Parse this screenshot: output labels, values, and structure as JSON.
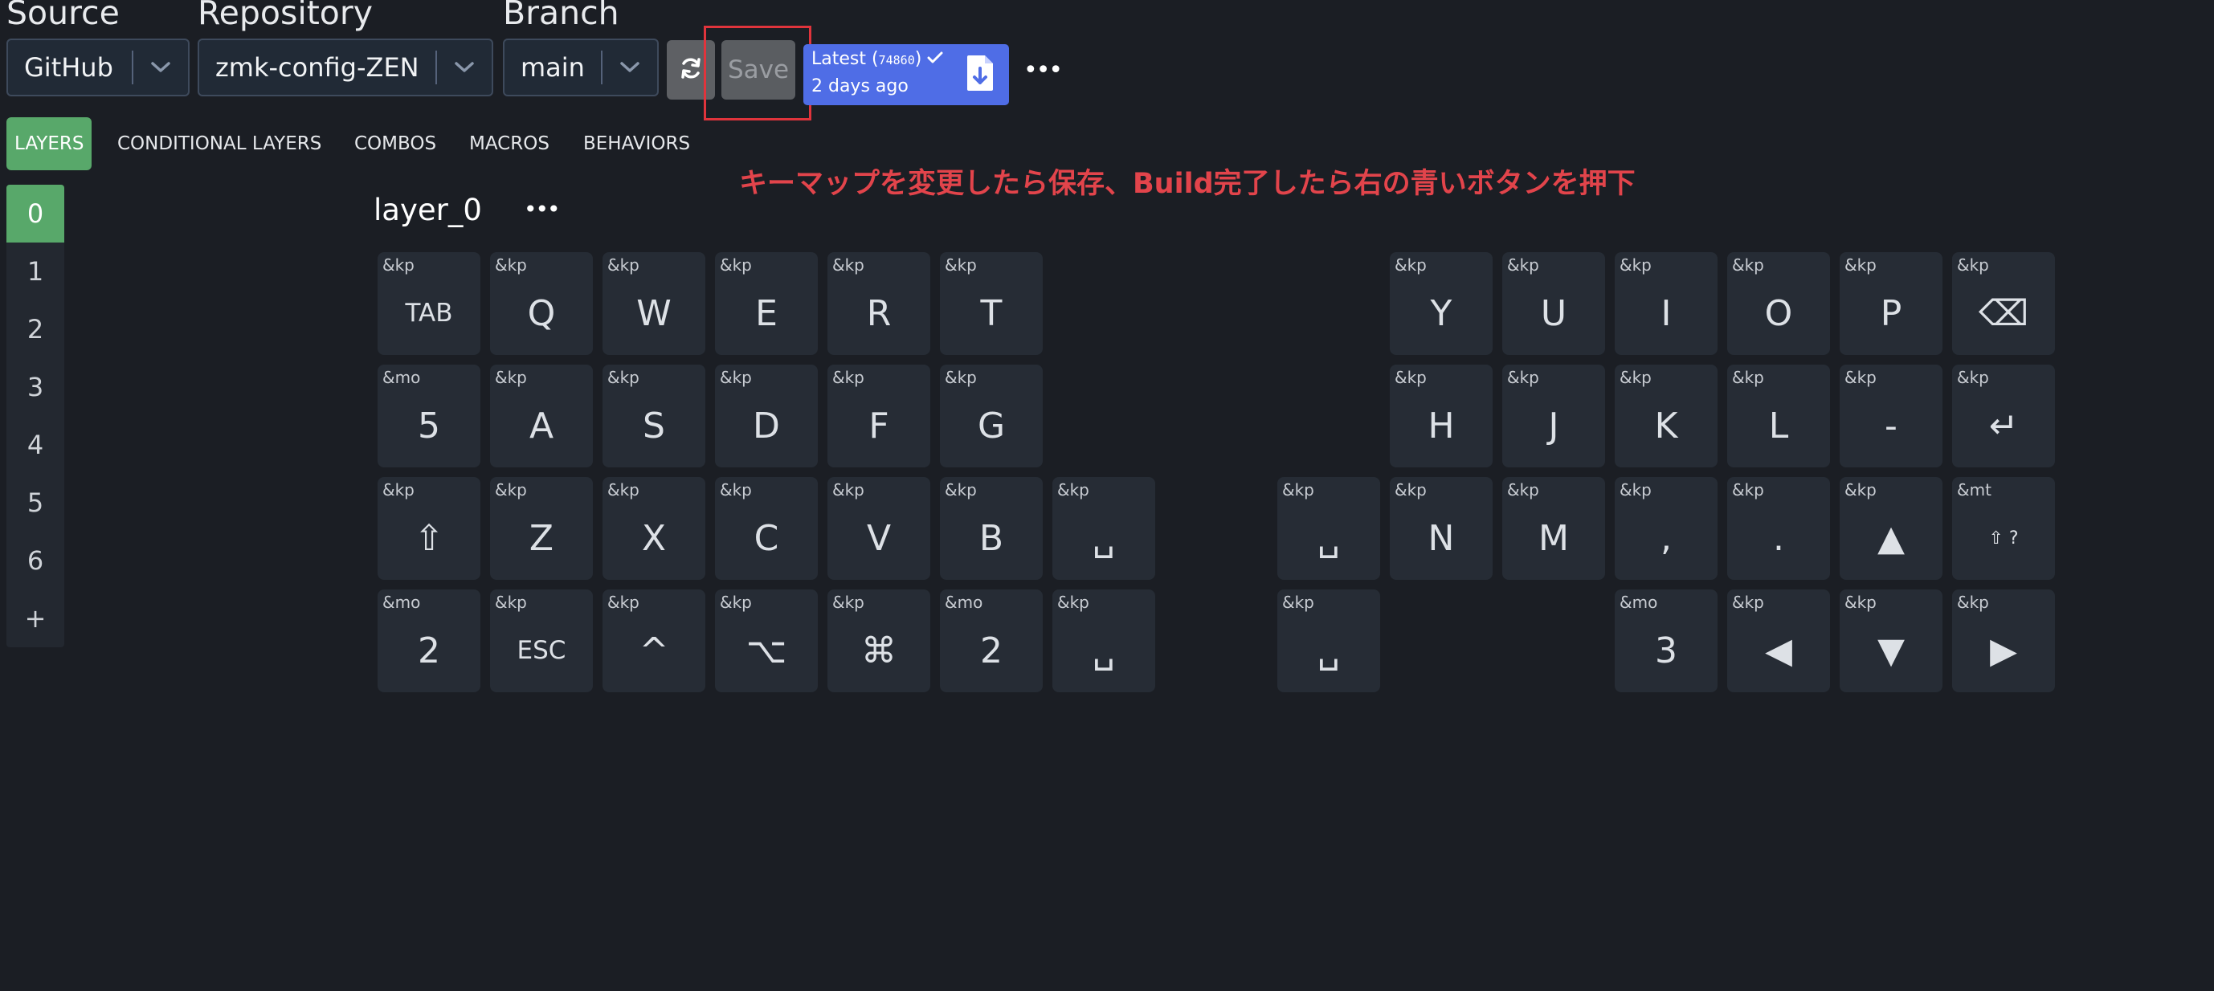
{
  "toolbar": {
    "source_label": "Source",
    "source_value": "GitHub",
    "repository_label": "Repository",
    "repository_value": "zmk-config-ZEN",
    "branch_label": "Branch",
    "branch_value": "main",
    "save_label": "Save",
    "build_status": "Latest",
    "build_hash": "74860",
    "build_time": "2 days ago",
    "more": "•••"
  },
  "tabs": [
    "LAYERS",
    "CONDITIONAL LAYERS",
    "COMBOS",
    "MACROS",
    "BEHAVIORS"
  ],
  "annotation": "キーマップを変更したら保存、Build完了したら右の青いボタンを押下",
  "layers": [
    "0",
    "1",
    "2",
    "3",
    "4",
    "5",
    "6",
    "+"
  ],
  "layer_title": "layer_0",
  "keys": [
    {
      "beh": "&kp",
      "label": "TAB"
    },
    {
      "beh": "&kp",
      "label": "Q"
    },
    {
      "beh": "&kp",
      "label": "W"
    },
    {
      "beh": "&kp",
      "label": "E"
    },
    {
      "beh": "&kp",
      "label": "R"
    },
    {
      "beh": "&kp",
      "label": "T"
    },
    {
      "beh": "&kp",
      "label": "Y"
    },
    {
      "beh": "&kp",
      "label": "U"
    },
    {
      "beh": "&kp",
      "label": "I"
    },
    {
      "beh": "&kp",
      "label": "O"
    },
    {
      "beh": "&kp",
      "label": "P"
    },
    {
      "beh": "&kp",
      "label": "⌫"
    },
    {
      "beh": "&mo",
      "label": "5"
    },
    {
      "beh": "&kp",
      "label": "A"
    },
    {
      "beh": "&kp",
      "label": "S"
    },
    {
      "beh": "&kp",
      "label": "D"
    },
    {
      "beh": "&kp",
      "label": "F"
    },
    {
      "beh": "&kp",
      "label": "G"
    },
    {
      "beh": "&kp",
      "label": "H"
    },
    {
      "beh": "&kp",
      "label": "J"
    },
    {
      "beh": "&kp",
      "label": "K"
    },
    {
      "beh": "&kp",
      "label": "L"
    },
    {
      "beh": "&kp",
      "label": "-"
    },
    {
      "beh": "&kp",
      "label": "↵"
    },
    {
      "beh": "&kp",
      "label": "⇧"
    },
    {
      "beh": "&kp",
      "label": "Z"
    },
    {
      "beh": "&kp",
      "label": "X"
    },
    {
      "beh": "&kp",
      "label": "C"
    },
    {
      "beh": "&kp",
      "label": "V"
    },
    {
      "beh": "&kp",
      "label": "B"
    },
    {
      "beh": "&kp",
      "label": "␣"
    },
    {
      "beh": "&kp",
      "label": "␣"
    },
    {
      "beh": "&kp",
      "label": "N"
    },
    {
      "beh": "&kp",
      "label": "M"
    },
    {
      "beh": "&kp",
      "label": ","
    },
    {
      "beh": "&kp",
      "label": "."
    },
    {
      "beh": "&kp",
      "label": "▲"
    },
    {
      "beh": "&mt",
      "label": "⇧ ?"
    },
    {
      "beh": "&mo",
      "label": "2"
    },
    {
      "beh": "&kp",
      "label": "ESC"
    },
    {
      "beh": "&kp",
      "label": "^"
    },
    {
      "beh": "&kp",
      "label": "⌥"
    },
    {
      "beh": "&kp",
      "label": "⌘"
    },
    {
      "beh": "&mo",
      "label": "2"
    },
    {
      "beh": "&kp",
      "label": "␣"
    },
    {
      "beh": "&kp",
      "label": "␣"
    },
    {
      "beh": "&mo",
      "label": "3"
    },
    {
      "beh": "&kp",
      "label": "◀"
    },
    {
      "beh": "&kp",
      "label": "▼"
    },
    {
      "beh": "&kp",
      "label": "▶"
    }
  ]
}
